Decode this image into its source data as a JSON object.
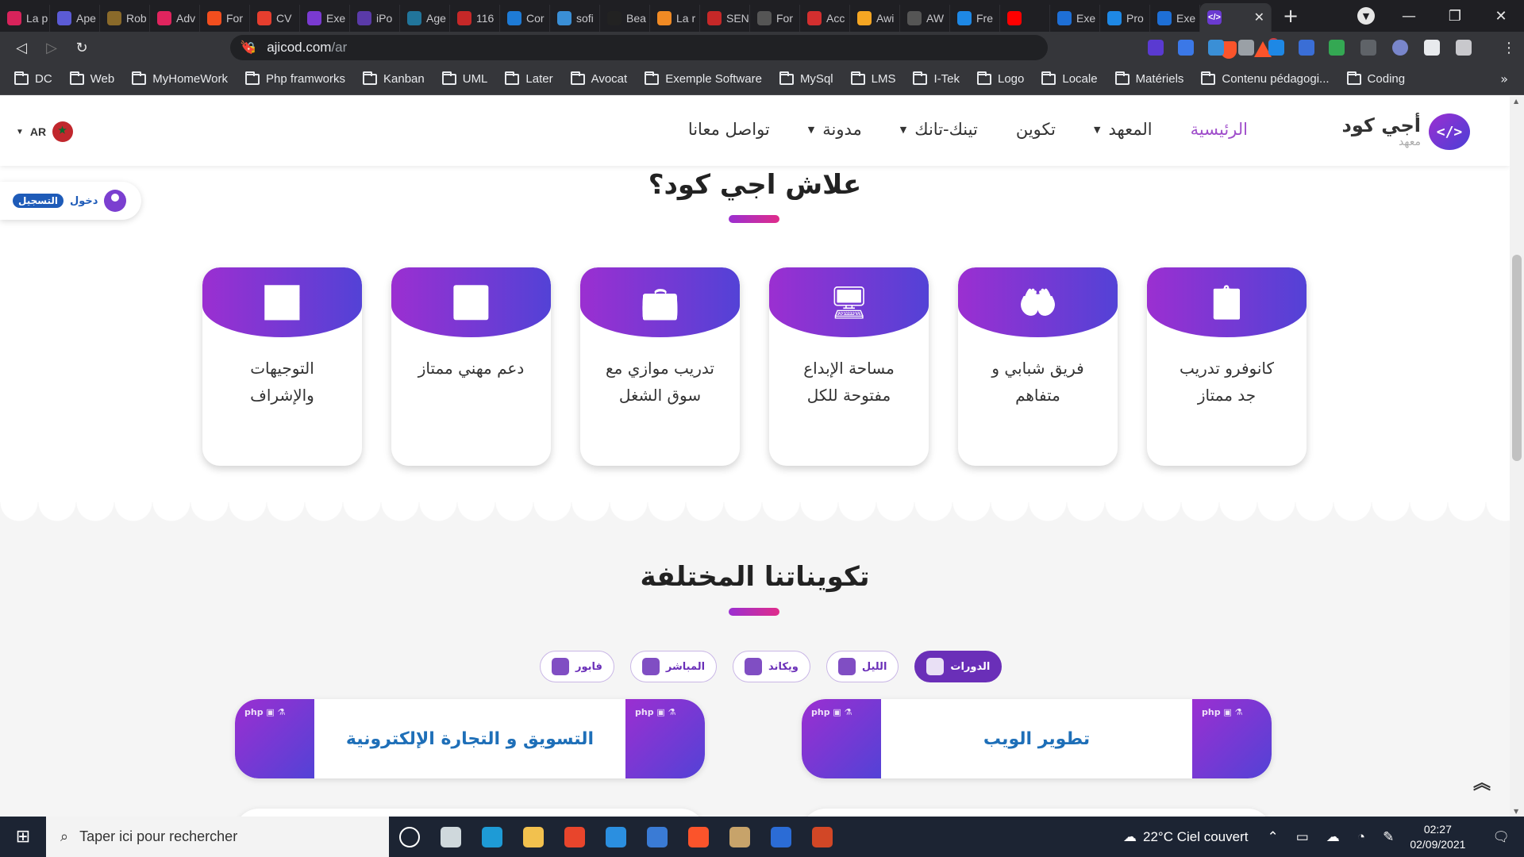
{
  "tabs": [
    {
      "label": "La p",
      "color": "#d8235b"
    },
    {
      "label": "Ape",
      "color": "#5b5bd6"
    },
    {
      "label": "Rob",
      "color": "#8a6a2a"
    },
    {
      "label": "Adv",
      "color": "#e0245e"
    },
    {
      "label": "For",
      "color": "#f24e1e"
    },
    {
      "label": "CV",
      "color": "#e63e2e"
    },
    {
      "label": "Exe",
      "color": "#7a3ad1"
    },
    {
      "label": "iPo",
      "color": "#5a3aa8"
    },
    {
      "label": "Age",
      "color": "#21759b"
    },
    {
      "label": "116",
      "color": "#c62828"
    },
    {
      "label": "Cor",
      "color": "#1e7bd6"
    },
    {
      "label": "sofi",
      "color": "#3a8fd6"
    },
    {
      "label": "Bea",
      "color": "#222222"
    },
    {
      "label": "La r",
      "color": "#f08a24"
    },
    {
      "label": "SEN",
      "color": "#c62828"
    },
    {
      "label": "For",
      "color": "#555555"
    },
    {
      "label": "Acc",
      "color": "#d32f2f"
    },
    {
      "label": "Awi",
      "color": "#f5a623"
    },
    {
      "label": "AW",
      "color": "#555555"
    },
    {
      "label": "Fre",
      "color": "#1e88e5"
    },
    {
      "label": "",
      "color": "#ff0000"
    },
    {
      "label": "Exe",
      "color": "#1e6fd6"
    },
    {
      "label": "Pro",
      "color": "#1e88e5"
    },
    {
      "label": "Exe",
      "color": "#1e6fd6"
    }
  ],
  "active_tab": {
    "icon": "</>",
    "color": "#6a3ad1"
  },
  "address": {
    "domain": "ajicod.com",
    "path": "/ar"
  },
  "brave_badge": "1",
  "bookmarks": [
    "DC",
    "Web",
    "MyHomeWork",
    "Php framworks",
    "Kanban",
    "UML",
    "Later",
    "Avocat",
    "Exemple Software",
    "MySql",
    "LMS",
    "I-Tek",
    "Logo",
    "Locale",
    "Matériels",
    "Contenu pédagogi...",
    "Coding"
  ],
  "site": {
    "logo_title": "أجي كود",
    "logo_sub": "معهد",
    "nav": [
      {
        "label": "الرئيسية",
        "active": true,
        "caret": false
      },
      {
        "label": "المعهد",
        "active": false,
        "caret": true
      },
      {
        "label": "تكوين",
        "active": false,
        "caret": false
      },
      {
        "label": "تينك-تانك",
        "active": false,
        "caret": true
      },
      {
        "label": "مدونة",
        "active": false,
        "caret": true
      },
      {
        "label": "تواصل معانا",
        "active": false,
        "caret": false
      }
    ],
    "lang": "AR",
    "auth": {
      "login": "دخول",
      "signup": "التسجيل"
    }
  },
  "why": {
    "title": "علاش اجي كود؟",
    "cards": [
      {
        "text": "كانوفرو تدريب جد ممتاز",
        "icon": "clipboard-icon",
        "glyph": "📋"
      },
      {
        "text": "فريق شبابي و متفاهم",
        "icon": "heart-hand-icon",
        "glyph": "🤲"
      },
      {
        "text": "مساحة الإبداع مفتوحة للكل",
        "icon": "creative-desk-icon",
        "glyph": "🖥"
      },
      {
        "text": "تدريب موازي مع سوق الشغل",
        "icon": "briefcase-icon",
        "glyph": "💼"
      },
      {
        "text": "دعم مهني ممتاز",
        "icon": "sync-arrows-icon",
        "glyph": "🔄"
      },
      {
        "text": "التوجيهات والإشراف",
        "icon": "presentation-icon",
        "glyph": "📊"
      }
    ]
  },
  "trainings": {
    "title": "تكويناتنا المختلفة",
    "filters": [
      {
        "label": "الدورات",
        "active": true
      },
      {
        "label": "الليل",
        "active": false
      },
      {
        "label": "ويكاند",
        "active": false
      },
      {
        "label": "المباشر",
        "active": false
      },
      {
        "label": "فابور",
        "active": false
      }
    ],
    "courses": [
      {
        "name": "تطوير الويب"
      },
      {
        "name": "التسويق و التجارة الإلكترونية"
      }
    ]
  },
  "taskbar": {
    "search_placeholder": "Taper ici pour rechercher",
    "weather": "22°C  Ciel couvert",
    "time": "02:27",
    "date": "02/09/2021",
    "apps": [
      {
        "name": "task-view",
        "color": "#ffffff"
      },
      {
        "name": "widgets",
        "color": "#cfd8dc"
      },
      {
        "name": "edge",
        "color": "#1e9bd6"
      },
      {
        "name": "explorer",
        "color": "#f2c14e"
      },
      {
        "name": "office",
        "color": "#e8452c"
      },
      {
        "name": "vscode",
        "color": "#2b8fe0"
      },
      {
        "name": "remote",
        "color": "#3a7bd5"
      },
      {
        "name": "brave",
        "color": "#fb542b"
      },
      {
        "name": "paint",
        "color": "#c7a36a"
      },
      {
        "name": "word",
        "color": "#2b6cd6"
      },
      {
        "name": "powerpoint",
        "color": "#d24726"
      }
    ]
  }
}
